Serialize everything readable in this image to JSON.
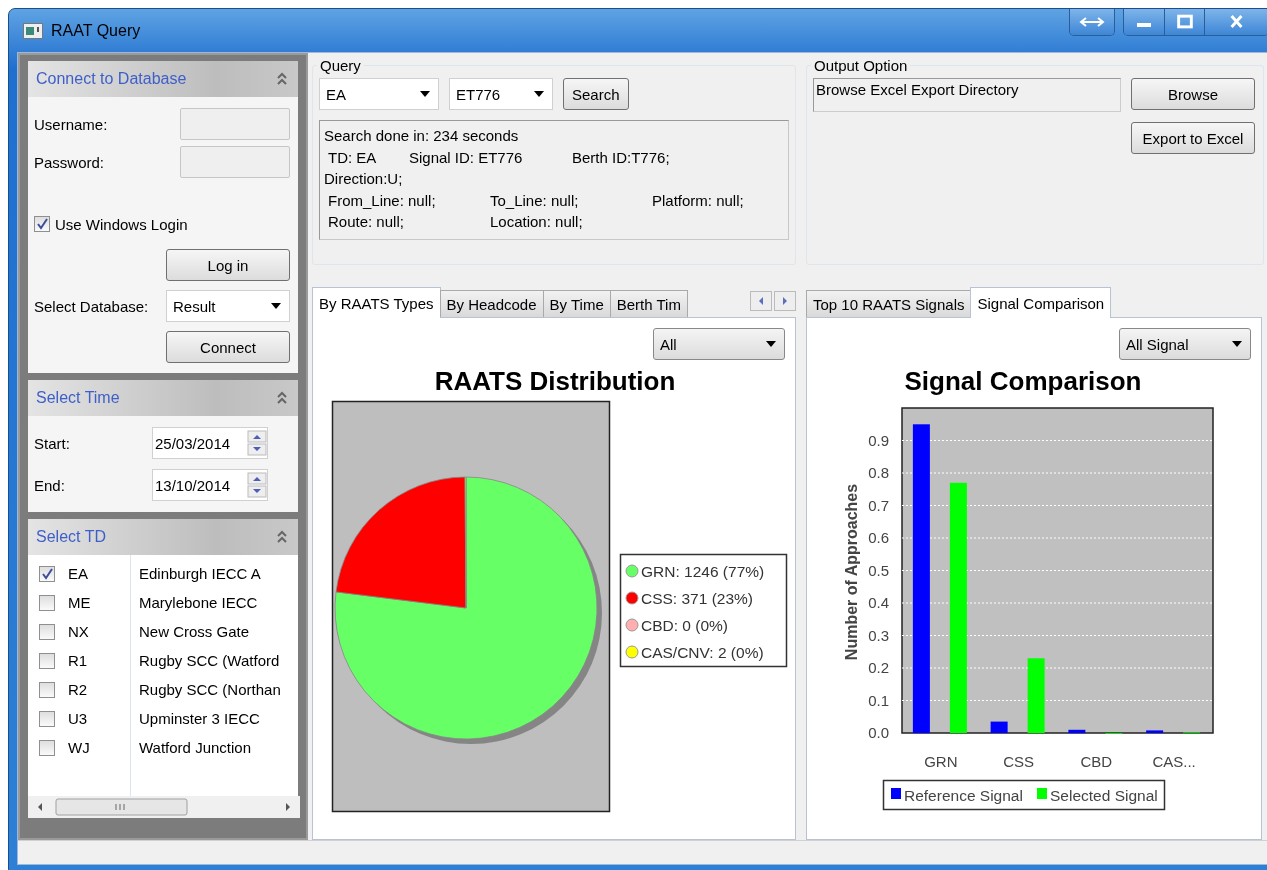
{
  "window": {
    "title": "RAAT Query"
  },
  "connect_panel": {
    "title": "Connect to Database",
    "username_label": "Username:",
    "password_label": "Password:",
    "windows_login": {
      "label": "Use Windows Login",
      "checked": true
    },
    "login_button": "Log in",
    "database_label": "Select Database:",
    "database": "Result",
    "connect_button": "Connect"
  },
  "time_panel": {
    "title": "Select Time",
    "start_label": "Start:",
    "start": "25/03/2014",
    "end_label": "End:",
    "end": "13/10/2014"
  },
  "td_panel": {
    "title": "Select TD",
    "items": [
      {
        "code": "EA",
        "name": "Edinburgh IECC A",
        "checked": true
      },
      {
        "code": "ME",
        "name": "Marylebone IECC",
        "checked": false
      },
      {
        "code": "NX",
        "name": "New Cross Gate",
        "checked": false
      },
      {
        "code": "R1",
        "name": "Rugby SCC (Watford",
        "checked": false
      },
      {
        "code": "R2",
        "name": "Rugby SCC (Northan",
        "checked": false
      },
      {
        "code": "U3",
        "name": "Upminster 3 IECC",
        "checked": false
      },
      {
        "code": "WJ",
        "name": "Watford Junction",
        "checked": false
      }
    ]
  },
  "query": {
    "title": "Query",
    "td": "EA",
    "signal": "ET776",
    "search_button": "Search",
    "result_lines": [
      [
        "Search done in: 234 seconds"
      ],
      [
        "TD: EA",
        "Signal ID: ET776",
        "Berth ID:T776;"
      ],
      [
        "Direction:U;"
      ],
      [
        "From_Line: null;",
        "To_Line: null;",
        "Platform: null;"
      ],
      [
        "Route: null;",
        "Location: null;"
      ]
    ]
  },
  "output": {
    "title": "Output Option",
    "directory": "Browse Excel Export Directory",
    "browse_button": "Browse",
    "export_button": "Export to Excel"
  },
  "types_panel": {
    "tabs": [
      {
        "label": "By RAATS Types",
        "selected": true
      },
      {
        "label": "By Headcode",
        "selected": false
      },
      {
        "label": "By Time",
        "selected": false
      },
      {
        "label": "Berth Tim",
        "selected": false
      }
    ],
    "filter": "All",
    "chart_data": {
      "type": "pie",
      "title": "RAATS Distribution",
      "categories": [
        "GRN: 1246 (77%)",
        "CSS: 371 (23%)",
        "CBD: 0 (0%)",
        "CAS/CNV: 2 (0%)"
      ],
      "values": [
        1246,
        371,
        0,
        2
      ],
      "colors": [
        "#66ff66",
        "#ff0000",
        "#ffafaf",
        "#ffff00"
      ],
      "legend": "right"
    }
  },
  "compare_panel": {
    "tabs": [
      {
        "label": "Top 10 RAATS Signals",
        "selected": false
      },
      {
        "label": "Signal Comparison",
        "selected": true
      }
    ],
    "filter": "All Signal",
    "chart_data": {
      "type": "bar",
      "title": "Signal Comparison",
      "ylabel": "Number of Approaches",
      "categories": [
        "GRN",
        "CSS",
        "CBD",
        "CAS..."
      ],
      "series": [
        {
          "name": "Reference Signal",
          "color": "#0000ff",
          "values": [
            0.95,
            0.035,
            0.01,
            0.008
          ]
        },
        {
          "name": "Selected Signal",
          "color": "#00ff00",
          "values": [
            0.77,
            0.23,
            0,
            0.002
          ]
        }
      ],
      "ylim": [
        0,
        1
      ],
      "grid": true,
      "legend": "bottom",
      "yticks": [
        {
          "value": 0,
          "label": "0.0"
        },
        0.1,
        0.2,
        0.3,
        0.4,
        0.5,
        0.6,
        0.7,
        0.8,
        0.9
      ]
    }
  }
}
